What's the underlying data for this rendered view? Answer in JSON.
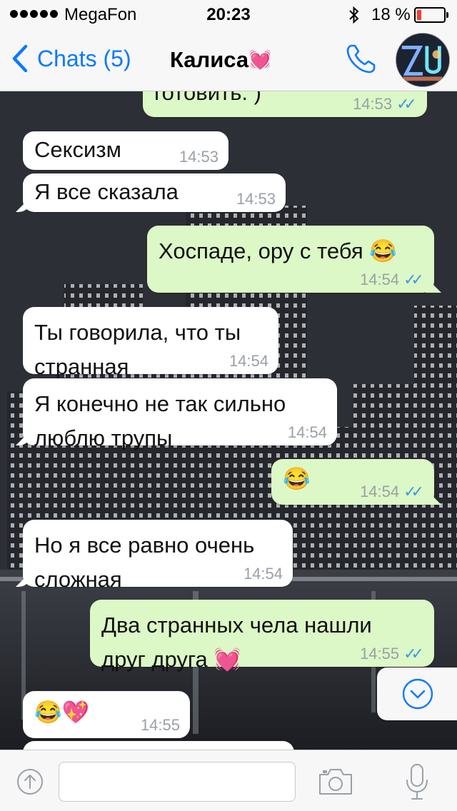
{
  "status_bar": {
    "carrier": "MegaFon",
    "time": "20:23",
    "bluetooth_icon": "bluetooth-icon",
    "battery_percent": "18 %",
    "battery_level": 0.18,
    "battery_color": "#ff3b30"
  },
  "nav": {
    "back_label": "Chats (5)",
    "contact_name": "Калиса",
    "contact_emoji": "💓",
    "accent_color": "#0a7aff"
  },
  "messages": [
    {
      "dir": "out",
      "text": "готовить. )",
      "time": "14:53",
      "read": true
    },
    {
      "dir": "in",
      "text": "Сексизм",
      "time": "14:53"
    },
    {
      "dir": "in",
      "text": "Я все сказала",
      "time": "14:53"
    },
    {
      "dir": "out",
      "text": "Хоспаде, ору с тебя 😂",
      "time": "14:54",
      "read": true
    },
    {
      "dir": "in",
      "text": "Ты говорила, что ты\nстранная",
      "time": "14:54"
    },
    {
      "dir": "in",
      "text": "Я конечно не так сильно\nлюблю трупы",
      "time": "14:54"
    },
    {
      "dir": "out",
      "text": "😂",
      "time": "14:54",
      "read": true
    },
    {
      "dir": "in",
      "text": "Но я все равно очень\nсложная",
      "time": "14:54"
    },
    {
      "dir": "out",
      "text": "Два странных чела нашли\nдруг друга 💓",
      "time": "14:55",
      "read": true
    },
    {
      "dir": "in",
      "text": "😂💖",
      "time": "14:55"
    }
  ],
  "read_ticks": "✓✓",
  "input": {
    "value": "",
    "placeholder": ""
  },
  "colors": {
    "incoming_bubble": "#ffffff",
    "outgoing_bubble": "#dcf8c6",
    "read_ticks": "#3b9ae1"
  }
}
